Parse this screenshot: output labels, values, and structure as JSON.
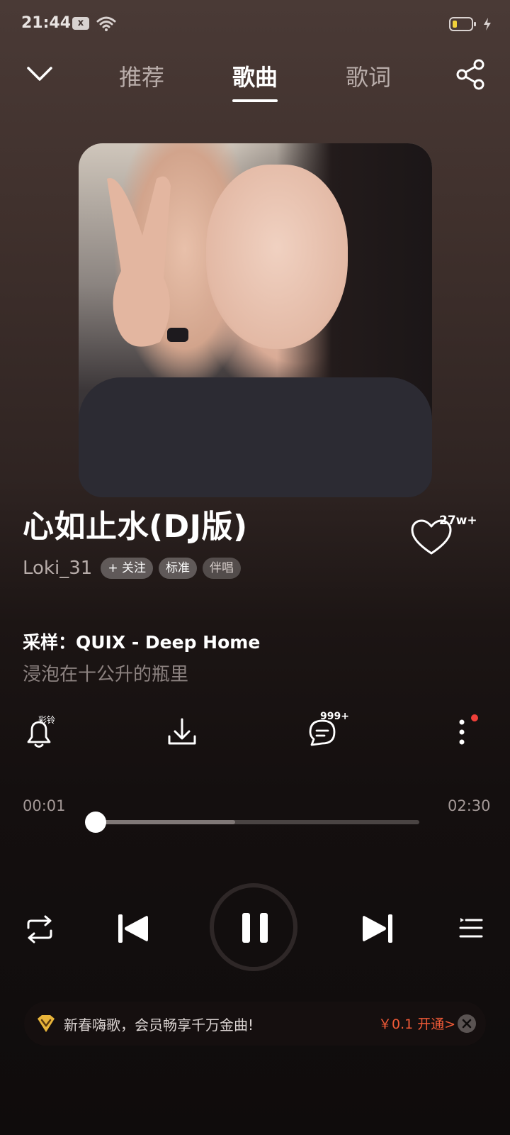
{
  "status_bar": {
    "time": "21:44",
    "notification_icon": "x"
  },
  "nav": {
    "tabs": [
      "推荐",
      "歌曲",
      "歌词"
    ],
    "active_tab": "歌曲"
  },
  "song": {
    "title": "心如止水(DJ版)",
    "artist": "Loki_31",
    "follow_label": "+ 关注",
    "quality_label": "标准",
    "accompaniment_label": "伴唱",
    "like_count": "27w+",
    "sample_line": "采样：QUIX - Deep Home",
    "current_lyric": "浸泡在十公升的瓶里"
  },
  "actions": {
    "ringtone_label": "彩铃",
    "comment_count": "999+"
  },
  "progress": {
    "current_time": "00:01",
    "total_time": "02:30",
    "played_fraction": 0.0,
    "buffered_fraction": 0.43
  },
  "promo": {
    "text": "新春嗨歌，会员畅享千万金曲!",
    "price_cta": "￥0.1 开通>"
  },
  "colors": {
    "accent_promo": "#f05a37",
    "badge_dot": "#f0403a",
    "battery_fill": "#f2d23a"
  },
  "icons": {
    "collapse": "chevron-down-icon",
    "share": "share-icon",
    "like": "heart-icon",
    "ringtone": "bell-icon",
    "download": "download-icon",
    "comment": "comment-icon",
    "more": "more-vertical-icon",
    "repeat": "repeat-icon",
    "prev": "skip-previous-icon",
    "pause": "pause-icon",
    "next": "skip-next-icon",
    "playlist": "playlist-icon",
    "vip": "vip-diamond-icon",
    "close": "close-icon"
  }
}
